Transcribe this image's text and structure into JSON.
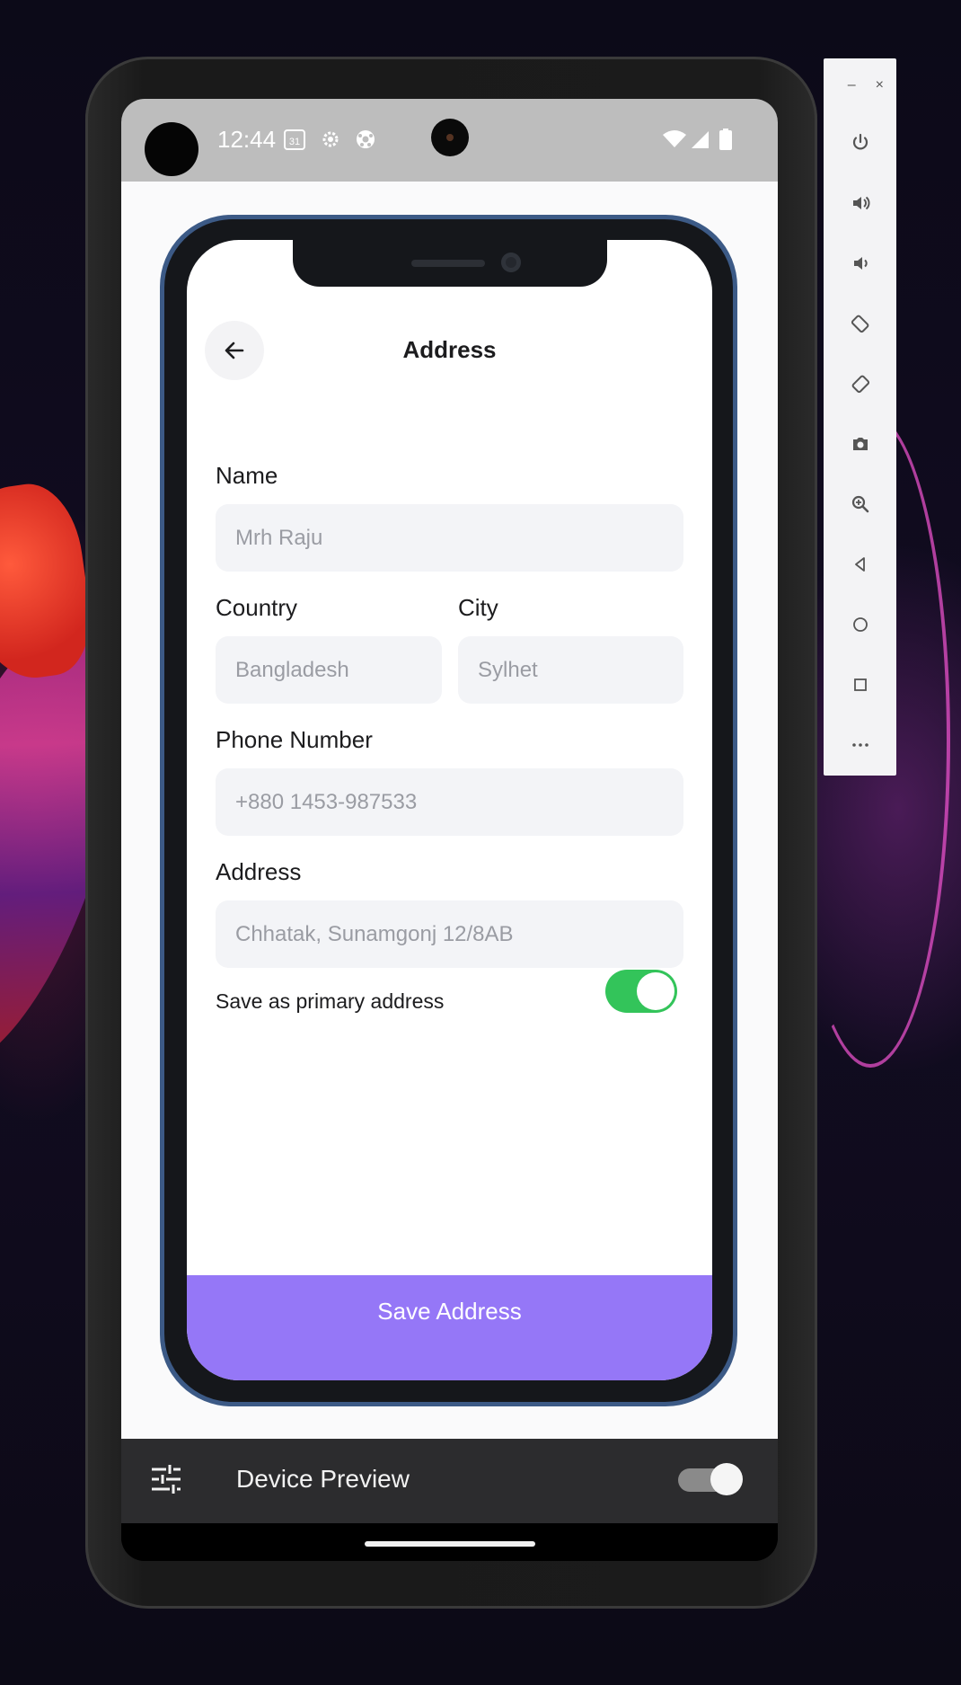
{
  "status_bar": {
    "time": "12:44",
    "calendar_day": "31",
    "icons": [
      "calendar-icon",
      "settings-gear-icon",
      "soccer-ball-icon",
      "wifi-icon",
      "signal-icon",
      "battery-icon"
    ]
  },
  "emulator_panel": {
    "minimize_label": "–",
    "close_label": "×",
    "tools": [
      "power-icon",
      "volume-up-icon",
      "volume-down-icon",
      "rotate-left-icon",
      "rotate-right-icon",
      "camera-icon",
      "zoom-icon",
      "back-icon",
      "home-icon",
      "overview-icon",
      "more-icon"
    ]
  },
  "address_page": {
    "title": "Address",
    "name_label": "Name",
    "name_placeholder": "Mrh Raju",
    "country_label": "Country",
    "country_placeholder": "Bangladesh",
    "city_label": "City",
    "city_placeholder": "Sylhet",
    "phone_label": "Phone Number",
    "phone_placeholder": "+880 1453-987533",
    "address_label": "Address",
    "address_placeholder": "Chhatak, Sunamgonj 12/8AB",
    "primary_toggle_label": "Save as primary address",
    "primary_toggle_on": true,
    "save_button": "Save Address"
  },
  "device_preview_bar": {
    "label": "Device Preview",
    "enabled": true
  },
  "colors": {
    "accent_purple": "#9577f7",
    "toggle_green": "#33c45a",
    "frame_blue": "#3c5a86"
  }
}
